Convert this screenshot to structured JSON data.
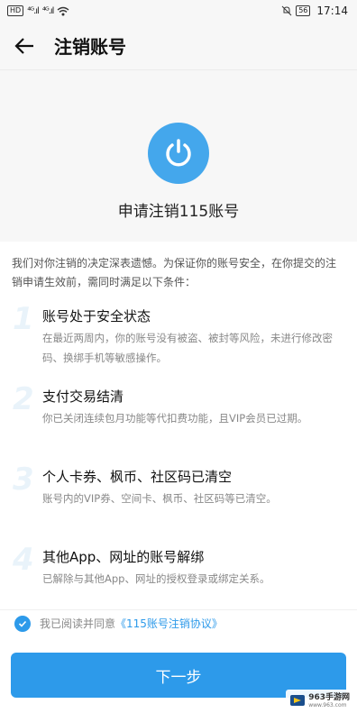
{
  "status_bar": {
    "hd_badge": "HD",
    "signal_1": "⁴ᴳ.ıl",
    "signal_2": "⁴ᴳ.ıl",
    "battery": "56",
    "time": "17:14"
  },
  "nav": {
    "back_icon": "arrow-left-icon",
    "title": "注销账号"
  },
  "hero": {
    "icon": "power-icon",
    "title": "申请注销115账号"
  },
  "intro": "我们对你注销的决定深表遗憾。为保证你的账号安全，在你提交的注销申请生效前，需同时满足以下条件：",
  "conditions": [
    {
      "num": "1",
      "title": "账号处于安全状态",
      "desc": "在最近两周内，你的账号没有被盗、被封等风险，未进行修改密码、换绑手机等敏感操作。"
    },
    {
      "num": "2",
      "title": "支付交易结清",
      "desc": "你已关闭连续包月功能等代扣费功能，且VIP会员已过期。"
    },
    {
      "num": "3",
      "title": "个人卡券、枫币、社区码已清空",
      "desc": "账号内的VIP券、空间卡、枫币、社区码等已清空。"
    },
    {
      "num": "4",
      "title": "其他App、网址的账号解绑",
      "desc": "已解除与其他App、网址的授权登录或绑定关系。"
    }
  ],
  "agree": {
    "checked": true,
    "text": "我已阅读并同意",
    "link": "《115账号注销协议》"
  },
  "next_button": "下一步",
  "watermark": {
    "text": "963手游网",
    "sub": "www.963.com"
  },
  "colors": {
    "accent": "#2d9aea",
    "power_bg": "#44a7ec"
  }
}
